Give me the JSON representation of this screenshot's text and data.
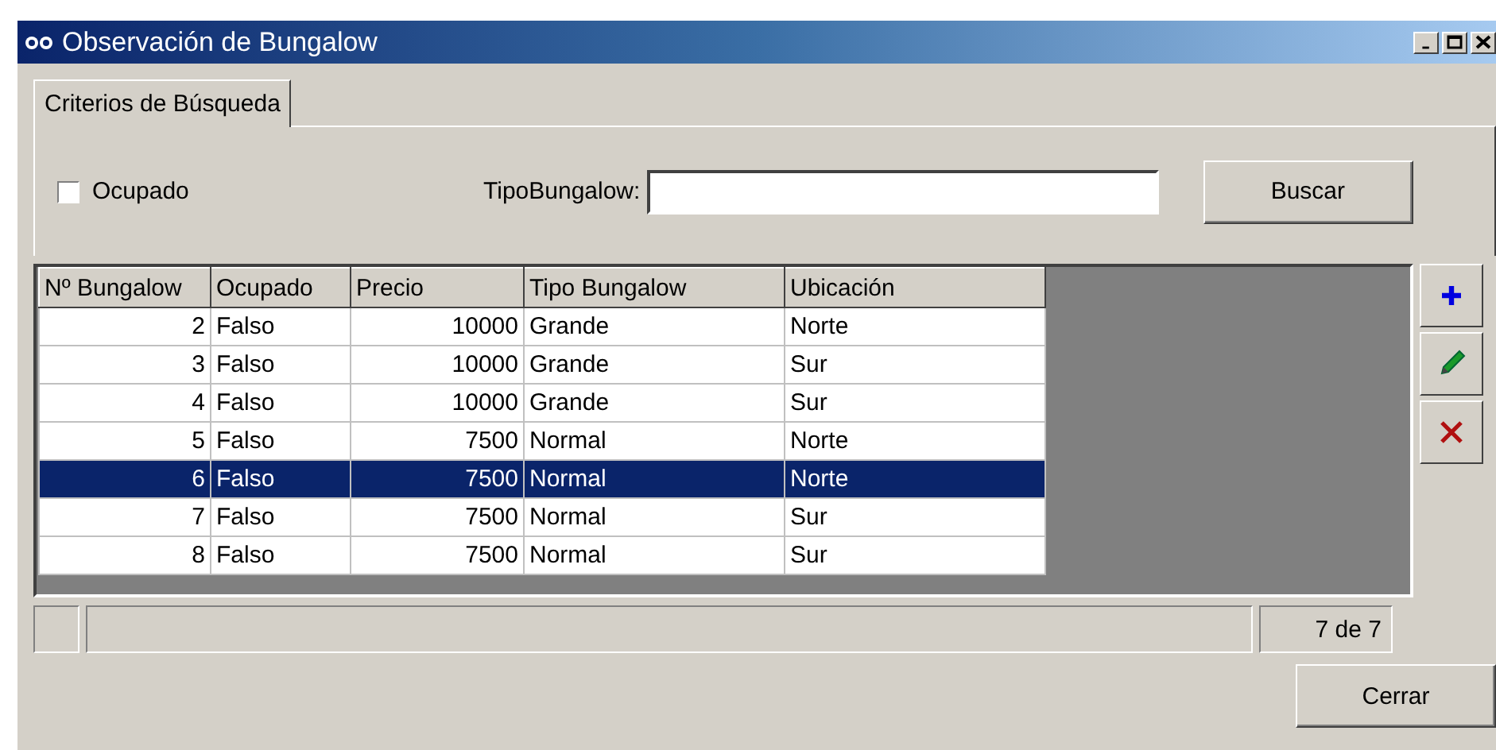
{
  "window": {
    "title": "Observación de Bungalow"
  },
  "tabs": [
    {
      "label": "Criterios de Búsqueda",
      "selected": true
    }
  ],
  "search": {
    "checkbox": {
      "label": "Ocupado",
      "checked": false
    },
    "field": {
      "label": "TipoBungalow:"
    },
    "button": "Buscar"
  },
  "table": {
    "columns": [
      {
        "label": "Nº Bungalow",
        "kind": "number"
      },
      {
        "label": "Ocupado",
        "kind": "text"
      },
      {
        "label": "Precio",
        "kind": "number"
      },
      {
        "label": "Tipo Bungalow",
        "kind": "text"
      },
      {
        "label": "Ubicación",
        "kind": "text"
      }
    ],
    "rows": [
      {
        "cells": [
          "2",
          "Falso",
          "10000",
          "Grande",
          "Norte"
        ],
        "selected": false
      },
      {
        "cells": [
          "3",
          "Falso",
          "10000",
          "Grande",
          "Sur"
        ],
        "selected": false
      },
      {
        "cells": [
          "4",
          "Falso",
          "10000",
          "Grande",
          "Sur"
        ],
        "selected": false
      },
      {
        "cells": [
          "5",
          "Falso",
          "7500",
          "Normal",
          "Norte"
        ],
        "selected": false
      },
      {
        "cells": [
          "6",
          "Falso",
          "7500",
          "Normal",
          "Norte"
        ],
        "selected": true
      },
      {
        "cells": [
          "7",
          "Falso",
          "7500",
          "Normal",
          "Sur"
        ],
        "selected": false
      },
      {
        "cells": [
          "8",
          "Falso",
          "7500",
          "Normal",
          "Sur"
        ],
        "selected": false
      }
    ]
  },
  "side_buttons": [
    {
      "kind": "add"
    },
    {
      "kind": "edit"
    },
    {
      "kind": "delete"
    }
  ],
  "status_bar": {
    "count": "7 de 7"
  },
  "close_button": "Cerrar"
}
